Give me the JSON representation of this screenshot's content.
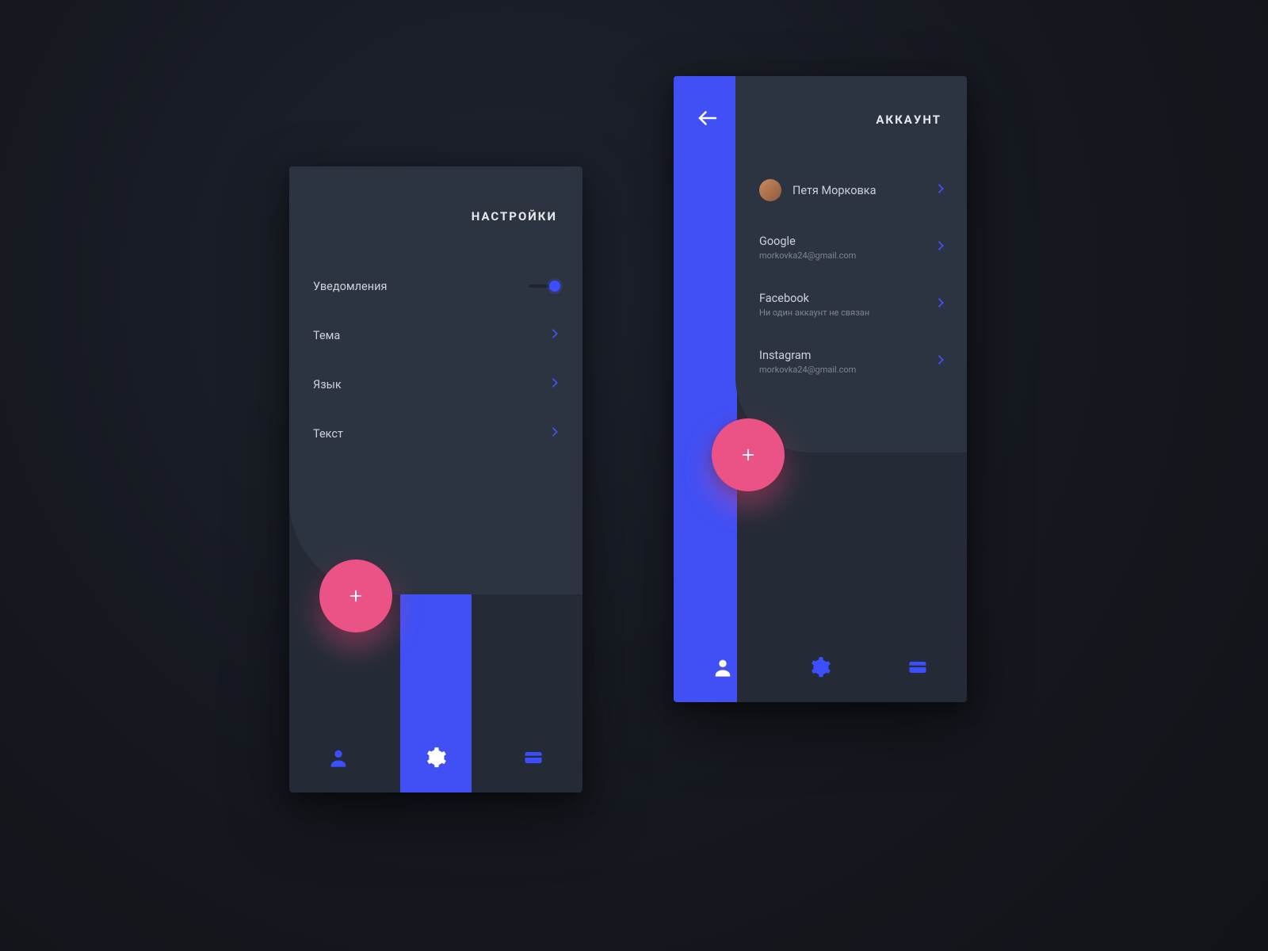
{
  "settings": {
    "title": "НАСТРОЙКИ",
    "rows": [
      {
        "label": "Уведомления",
        "control": "toggle",
        "on": true
      },
      {
        "label": "Тема",
        "control": "chevron"
      },
      {
        "label": "Язык",
        "control": "chevron"
      },
      {
        "label": "Текст",
        "control": "chevron"
      }
    ],
    "fab": "+",
    "nav": [
      "person",
      "gear",
      "card"
    ],
    "active_nav": 1
  },
  "account": {
    "title": "АККАУНТ",
    "profile": {
      "name": "Петя Морковка"
    },
    "links": [
      {
        "service": "Google",
        "detail": "morkovka24@gmail.com"
      },
      {
        "service": "Facebook",
        "detail": "Ни один аккаунт не связан"
      },
      {
        "service": "Instagram",
        "detail": "morkovka24@gmail.com"
      }
    ],
    "fab": "+",
    "nav": [
      "person",
      "gear",
      "card"
    ],
    "active_nav": 0
  },
  "colors": {
    "accent_blue": "#4050F5",
    "accent_pink": "#EB5286",
    "panel": "#2D3441",
    "background": "#181C24"
  }
}
